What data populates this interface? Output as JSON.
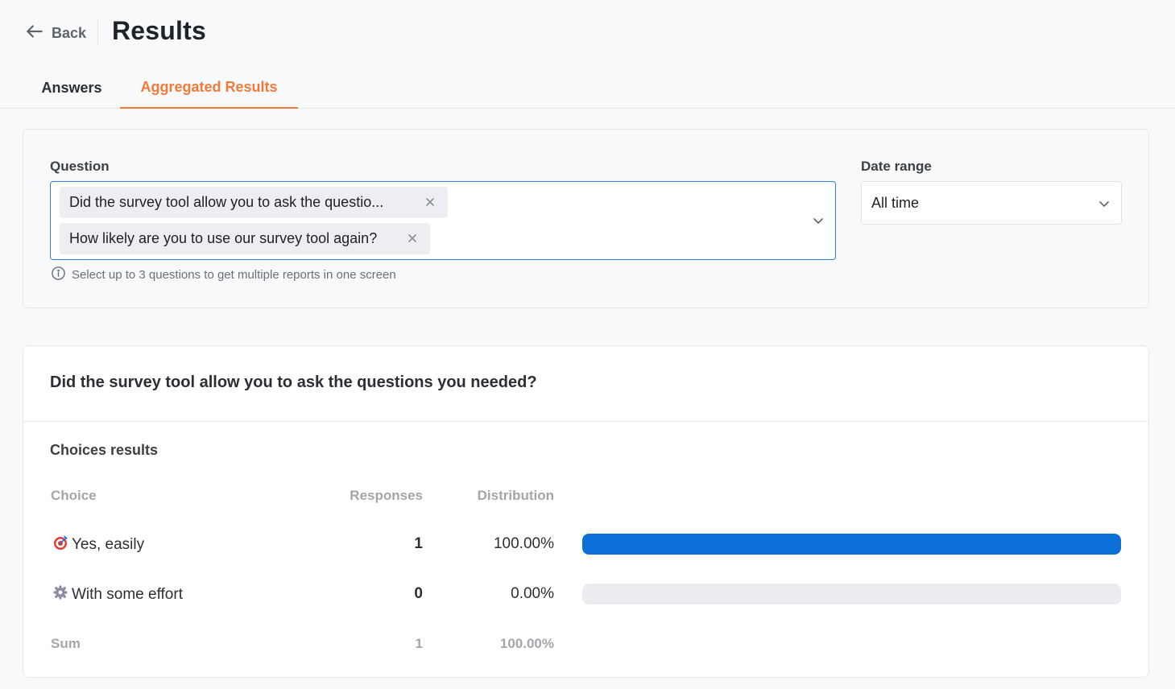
{
  "header": {
    "back_label": "Back",
    "title": "Results"
  },
  "tabs": [
    {
      "label": "Answers",
      "active": false
    },
    {
      "label": "Aggregated Results",
      "active": true
    }
  ],
  "filters": {
    "question_label": "Question",
    "selected_questions": [
      "Did the survey tool allow you to ask the questio...",
      "How likely are you to use our survey tool again?"
    ],
    "hint": "Select up to 3 questions to get multiple reports in one screen",
    "date_range_label": "Date range",
    "date_range_value": "All time"
  },
  "results": {
    "question_title": "Did the survey tool allow you to ask the questions you needed?",
    "section_title": "Choices results",
    "columns": {
      "choice": "Choice",
      "responses": "Responses",
      "distribution": "Distribution"
    },
    "rows": [
      {
        "icon": "target-icon",
        "choice": "Yes, easily",
        "responses": "1",
        "distribution": "100.00%",
        "fraction": 1.0
      },
      {
        "icon": "gear-icon",
        "choice": "With some effort",
        "responses": "0",
        "distribution": "0.00%",
        "fraction": 0.0
      }
    ],
    "sum": {
      "label": "Sum",
      "responses": "1",
      "distribution": "100.00%"
    }
  },
  "colors": {
    "accent": "#f07a3a",
    "bar_fill": "#0b6fd7",
    "bar_track": "#ebedf1",
    "focus_border": "#2d7fd6"
  }
}
